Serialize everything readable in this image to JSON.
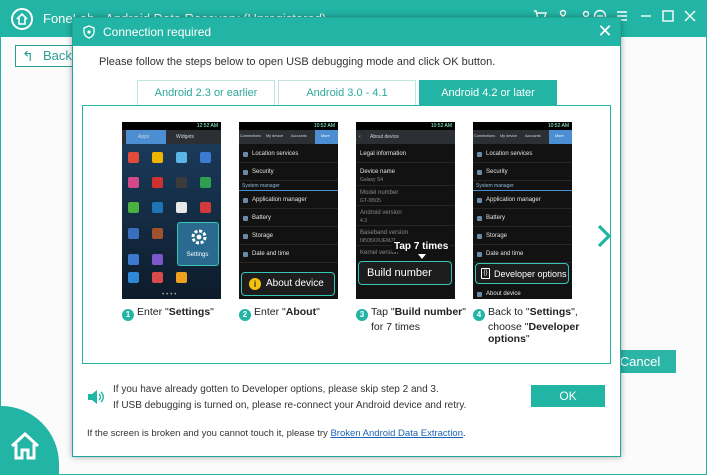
{
  "app": {
    "title": "FoneLab - Android Data Recovery (Unregistered)",
    "back_label": "Back",
    "cancel_label": "Cancel",
    "accent_color": "#22b4a5"
  },
  "dialog": {
    "title": "Connection required",
    "instruction": "Please follow the steps below to open USB debugging mode and click OK button.",
    "tabs": [
      {
        "label": "Android 2.3 or earlier",
        "active": false
      },
      {
        "label": "Android 3.0 - 4.1",
        "active": false
      },
      {
        "label": "Android 4.2 or later",
        "active": true
      }
    ],
    "screens": {
      "s1": {
        "tabs": [
          "Apps",
          "Widgets"
        ],
        "time": "12:52 AM",
        "highlight": "Settings"
      },
      "s2": {
        "time": "10:52 AM",
        "tabs": [
          "Connections",
          "My device",
          "Accounts",
          "More"
        ],
        "rows": [
          "Location services",
          "Security",
          "System manager",
          "Application manager",
          "Battery",
          "Storage",
          "Date and time"
        ],
        "callout": "About device"
      },
      "s3": {
        "time": "10:52 AM",
        "header": "About device",
        "rows": [
          "Legal information",
          "Device name",
          "Model number",
          "Android version",
          "Baseband version",
          "Kernel version"
        ],
        "subs": [
          "Galaxy S4",
          "GT-I9505",
          "4.3",
          "I9505XXUEMJ7"
        ],
        "tap_hint": "Tap 7 times",
        "callout": "Build number"
      },
      "s4": {
        "time": "10:52 AM",
        "tabs": [
          "Connections",
          "My device",
          "Accounts",
          "More"
        ],
        "rows": [
          "Location services",
          "Security",
          "System manager",
          "Application manager",
          "Battery",
          "Storage",
          "Date and time",
          "About device"
        ],
        "callout": "Developer options"
      }
    },
    "steps": [
      {
        "num": "1",
        "pre": "Enter \"",
        "bold": "Settings",
        "post": "\""
      },
      {
        "num": "2",
        "pre": "Enter \"",
        "bold": "About",
        "post": "\""
      },
      {
        "num": "3",
        "pre": "Tap \"",
        "bold": "Build number",
        "post": "\"",
        "line2": "for 7 times"
      },
      {
        "num": "4",
        "pre": "Back to \"",
        "bold": "Settings",
        "post": "\",",
        "line2_pre": "choose \"",
        "line2_bold": "Developer",
        "line3_bold": "options",
        "line3_post": "\""
      }
    ],
    "note1": "If you have already gotten to Developer options, please skip step 2 and 3.",
    "note2": "If USB debugging is turned on, please re-connect your Android device and retry.",
    "ok_label": "OK",
    "footer_text": "If the screen is broken and you cannot touch it, please try ",
    "footer_link": "Broken Android Data Extraction",
    "footer_end": "."
  }
}
